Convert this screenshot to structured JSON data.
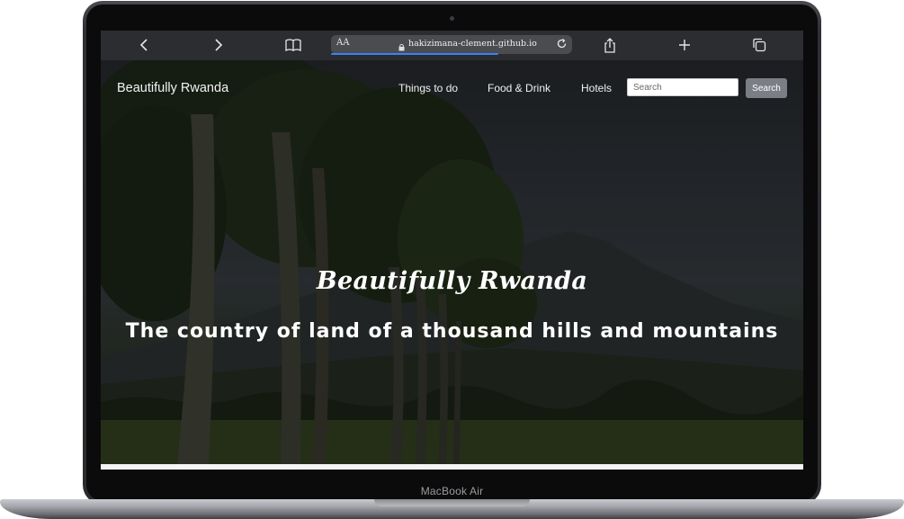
{
  "device": {
    "label": "MacBook Air"
  },
  "browser": {
    "reader_label": "AA",
    "url": "hakizimana-clement.github.io",
    "icons": [
      "back-icon",
      "forward-icon",
      "bookmarks-icon",
      "lock-icon",
      "reload-icon",
      "share-icon",
      "new-tab-icon",
      "tabs-icon"
    ]
  },
  "site": {
    "brand": "Beautifully Rwanda",
    "nav": [
      {
        "label": "Things to do"
      },
      {
        "label": "Food & Drink"
      },
      {
        "label": "Hotels"
      }
    ],
    "search": {
      "placeholder": "Search",
      "button_label": "Search"
    },
    "hero": {
      "title": "Beautifully Rwanda",
      "subtitle": "The country of land of a thousand hills and mountains"
    }
  }
}
